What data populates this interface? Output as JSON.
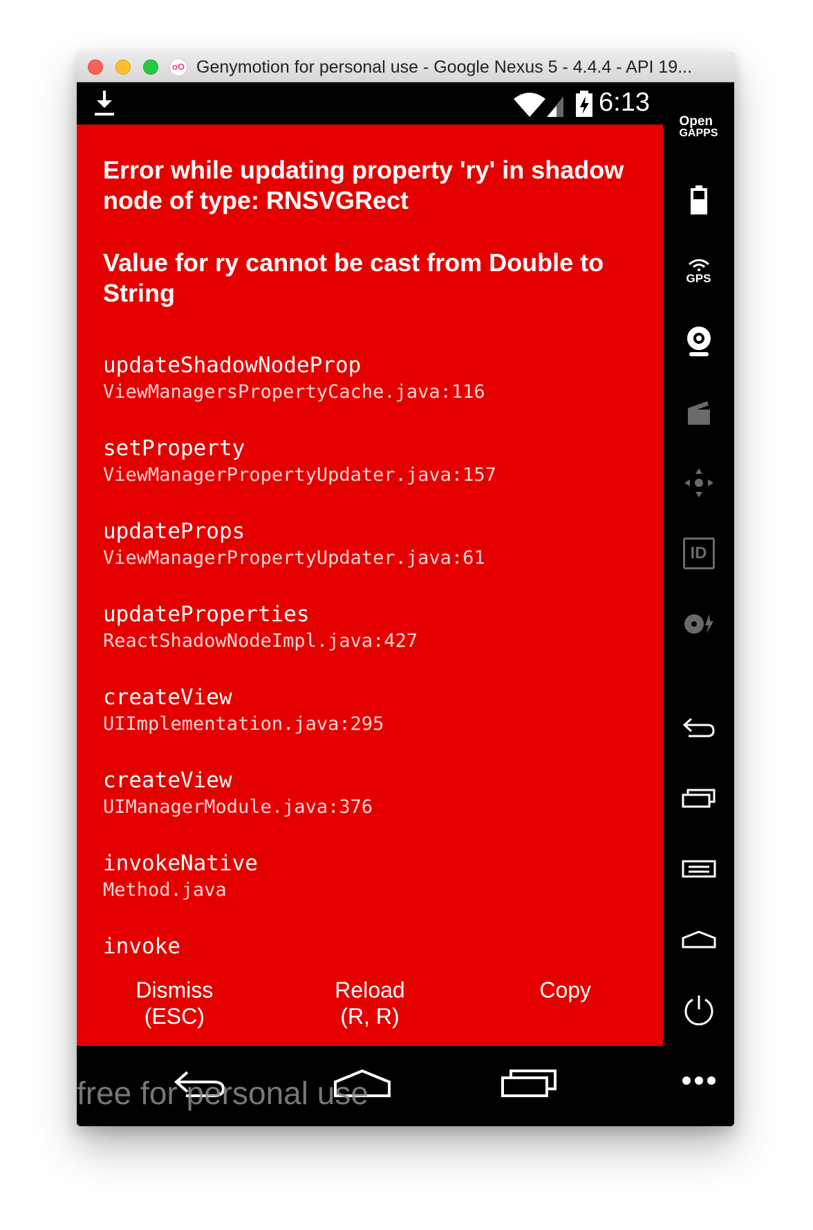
{
  "window": {
    "title": "Genymotion for personal use - Google Nexus 5 - 4.4.4 - API 19...",
    "logo_text": "oO"
  },
  "statusbar": {
    "time": "6:13"
  },
  "redbox": {
    "title": "Error while updating property 'ry' in shadow node of type: RNSVGRect",
    "message": "Value for ry cannot be cast from Double to String",
    "stack": [
      {
        "method": "updateShadowNodeProp",
        "file": "ViewManagersPropertyCache.java:116"
      },
      {
        "method": "setProperty",
        "file": "ViewManagerPropertyUpdater.java:157"
      },
      {
        "method": "updateProps",
        "file": "ViewManagerPropertyUpdater.java:61"
      },
      {
        "method": "updateProperties",
        "file": "ReactShadowNodeImpl.java:427"
      },
      {
        "method": "createView",
        "file": "UIImplementation.java:295"
      },
      {
        "method": "createView",
        "file": "UIManagerModule.java:376"
      },
      {
        "method": "invokeNative",
        "file": "Method.java"
      },
      {
        "method": "invoke",
        "file": ""
      }
    ],
    "buttons": {
      "dismiss_label": "Dismiss",
      "dismiss_shortcut": "(ESC)",
      "reload_label": "Reload",
      "reload_shortcut": "(R, R)",
      "copy_label": "Copy"
    }
  },
  "sidebar": {
    "opengapps_line1": "Open",
    "opengapps_line2": "GAPPS",
    "gps_label": "GPS",
    "id_label": "ID"
  },
  "watermark": {
    "text": "free for personal use"
  },
  "colors": {
    "redbox_bg": "#e50000",
    "frame_file": "#ffd3d3",
    "sidebar_bg": "#000000",
    "disabled_icon": "#6a6a6a"
  }
}
